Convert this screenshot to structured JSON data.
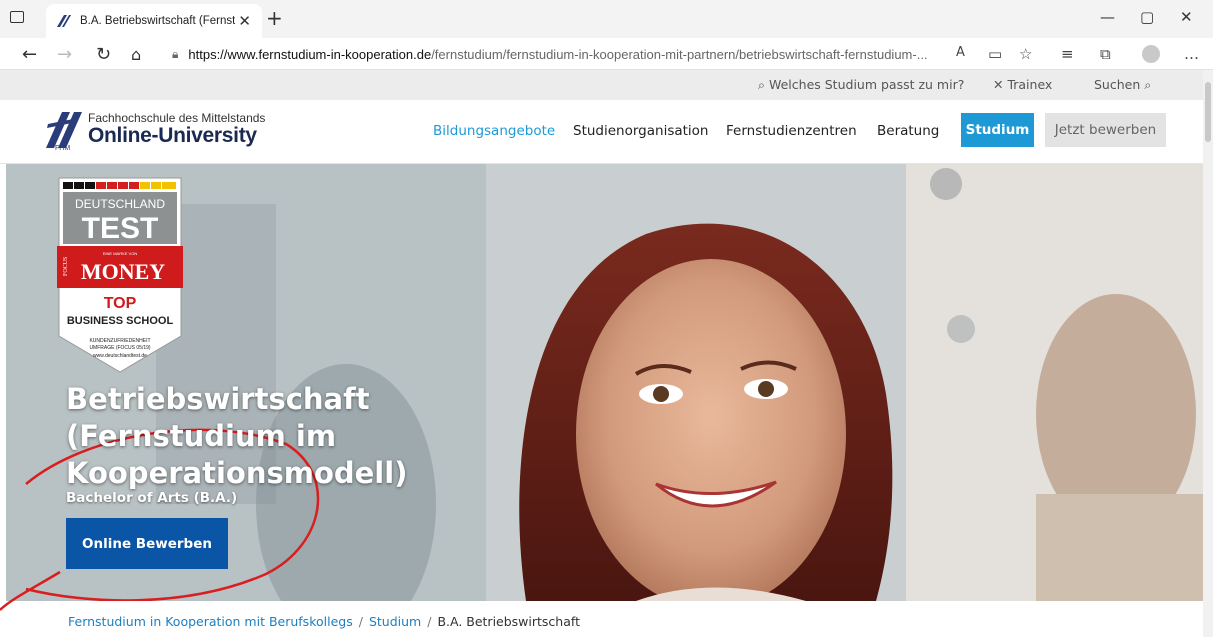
{
  "browser": {
    "tab_title": "B.A. Betriebswirtschaft (Fernstudi",
    "tab_close": "✕",
    "new_tab": "+",
    "url_host": "https://www.fernstudium-in-kooperation.de",
    "url_path": "/fernstudium/fernstudium-in-kooperation-mit-partnern/betriebswirtschaft-fernstudium-...",
    "window_buttons": {
      "minimize": "—",
      "restore": "▢",
      "close": "✕"
    },
    "icons": [
      "sidebar-icon",
      "favicon",
      "back-icon",
      "forward-icon",
      "reload-icon",
      "home-icon",
      "lock-icon",
      "read-aloud-icon",
      "immersive-reader-icon",
      "favorite-add-icon",
      "favorites-icon",
      "collections-icon",
      "profile-icon",
      "more-icon"
    ]
  },
  "utility": {
    "study_finder": "Welches Studium passt zu mir?",
    "trainex": "Trainex",
    "search": "Suchen"
  },
  "header": {
    "logo_sub": "Fachhochschule des Mittelstands",
    "logo_main": "Online-University",
    "logo_mark": "FHM",
    "nav": [
      "Bildungsangebote",
      "Studienorganisation",
      "Fernstudienzentren",
      "Beratung"
    ],
    "studium_button": "Studium",
    "apply_button": "Jetzt bewerben"
  },
  "badge": {
    "line1": "DEUTSCHLAND",
    "line2": "TEST",
    "brand_small": "EINE MARKE VON",
    "brand": "MONEY",
    "brand_focus": "FOCUS",
    "top": "TOP",
    "business": "BUSINESS SCHOOL",
    "small1": "KUNDENZUFRIEDENHEIT",
    "small2": "UMFRAGE (FOCUS 05/19)",
    "small3": "www.deutschlandtest.de"
  },
  "hero": {
    "title_line1": "Betriebswirtschaft",
    "title_line2": "(Fernstudium im",
    "title_line3": "Kooperationsmodell)",
    "subtitle": "Bachelor of Arts (B.A.)",
    "cta": "Online Bewerben"
  },
  "breadcrumb": {
    "items": [
      "Fernstudium in Kooperation mit Berufskollegs",
      "Studium",
      "B.A. Betriebswirtschaft"
    ],
    "separator": "/"
  },
  "colors": {
    "accent": "#1d9ad6",
    "cta": "#0a55a6",
    "annotation": "#d81e1e"
  }
}
